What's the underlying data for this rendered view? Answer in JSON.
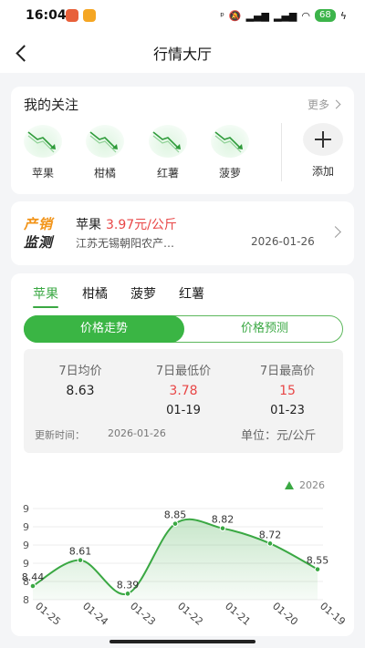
{
  "status_bar": {
    "time": "16:04",
    "battery": "68"
  },
  "nav": {
    "title": "行情大厅"
  },
  "favorites": {
    "title": "我的关注",
    "more": "更多",
    "items": [
      {
        "label": "苹果",
        "icon": "trend-down-icon"
      },
      {
        "label": "柑橘",
        "icon": "trend-down-icon"
      },
      {
        "label": "红薯",
        "icon": "trend-down-icon"
      },
      {
        "label": "菠萝",
        "icon": "trend-down-icon"
      }
    ],
    "add_label": "添加"
  },
  "monitor": {
    "logo_top": "产销",
    "logo_bottom": "监测",
    "product": "苹果",
    "price": "3.97元/公斤",
    "place": "江苏无锡朝阳农产…",
    "date": "2026-01-26"
  },
  "price_panel": {
    "tabs": [
      "苹果",
      "柑橘",
      "菠萝",
      "红薯"
    ],
    "toggle_on": "价格走势",
    "toggle_off": "价格预测",
    "stats": {
      "avg_label": "7日均价",
      "avg_value": "8.63",
      "min_label": "7日最低价",
      "min_value": "3.78",
      "min_date": "01-19",
      "max_label": "7日最高价",
      "max_value": "15",
      "max_date": "01-23"
    },
    "updated_label": "更新时间：",
    "updated_value": "2026-01-26",
    "unit": "单位：元/公斤",
    "legend": "2026"
  },
  "colors": {
    "accent": "#3aa843",
    "price_red": "#e84646",
    "logo_orange": "#f29419"
  },
  "chart_data": {
    "type": "area",
    "x": [
      "01-25",
      "01-24",
      "01-23",
      "01-22",
      "01-21",
      "01-20",
      "01-19"
    ],
    "series": [
      {
        "name": "2026",
        "values": [
          8.44,
          8.61,
          8.39,
          8.85,
          8.82,
          8.72,
          8.55
        ]
      }
    ],
    "ylim": [
      8.35,
      8.95
    ],
    "y_ticks": [
      "9",
      "9",
      "9",
      "9",
      "8",
      "8"
    ],
    "grid": true,
    "legend": "top-right"
  }
}
